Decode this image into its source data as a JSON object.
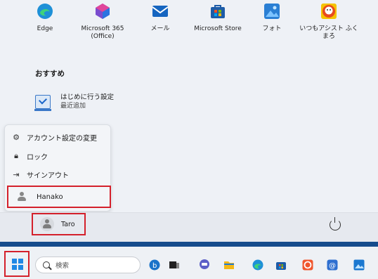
{
  "pinned_apps": [
    {
      "label": "Edge",
      "icon": "edge-icon",
      "color": "#1e90d7"
    },
    {
      "label": "Microsoft 365\n(Office)",
      "icon": "office-icon",
      "color": "#7a4ccf"
    },
    {
      "label": "メール",
      "icon": "mail-icon",
      "color": "#1565c0"
    },
    {
      "label": "Microsoft Store",
      "icon": "store-icon",
      "color": "#1d5ca8"
    },
    {
      "label": "フォト",
      "icon": "photos-icon",
      "color": "#2a7fd4"
    },
    {
      "label": "いつもアシスト ふく\nまろ",
      "icon": "fukumaro-icon",
      "color": "#e84b1e"
    }
  ],
  "recommended": {
    "title": "おすすめ",
    "items": [
      {
        "title": "はじめに行う設定",
        "subtitle": "最近追加"
      }
    ]
  },
  "user_menu": {
    "items": [
      {
        "label": "アカウント設定の変更",
        "icon": "account-settings-icon"
      },
      {
        "label": "ロック",
        "icon": "lock-icon"
      },
      {
        "label": "サインアウト",
        "icon": "sign-out-icon"
      }
    ],
    "other_user": "Hanako"
  },
  "current_user": "Taro",
  "taskbar": {
    "search_placeholder": "検索",
    "pinned": [
      {
        "icon": "bing-icon",
        "color": "#1a73c9"
      },
      {
        "icon": "task-view-icon",
        "color": "#222222"
      },
      {
        "icon": "chat-icon",
        "color": "#5b5fc7"
      },
      {
        "icon": "file-explorer-icon",
        "color": "#f3b816"
      },
      {
        "icon": "edge-icon",
        "color": "#1e90d7"
      },
      {
        "icon": "store-icon",
        "color": "#1d5ca8"
      },
      {
        "icon": "assist-icon",
        "color": "#f0562d"
      },
      {
        "icon": "at-mail-icon",
        "color": "#2e6fd0"
      },
      {
        "icon": "photo-app-icon",
        "color": "#1b78d0"
      }
    ]
  },
  "accent": "#d4202b"
}
